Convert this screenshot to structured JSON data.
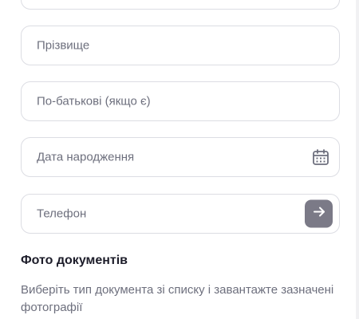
{
  "form": {
    "fields": [
      {
        "placeholder": ""
      },
      {
        "placeholder": "Прізвище"
      },
      {
        "placeholder": "По-батькові (якщо є)"
      },
      {
        "placeholder": "Дата народження",
        "icon": "calendar-icon"
      },
      {
        "placeholder": "Телефон",
        "button_icon": "arrow-right-icon"
      }
    ]
  },
  "documents": {
    "title": "Фото документів",
    "description": "Виберіть тип документа зі списку і завантажте зазначені фотографії"
  },
  "colors": {
    "border": "#dcdde3",
    "placeholder_text": "#6d6f7d",
    "heading_text": "#1d1d2a",
    "button_bg": "#7b7a87",
    "icon": "#6d6f7d"
  }
}
